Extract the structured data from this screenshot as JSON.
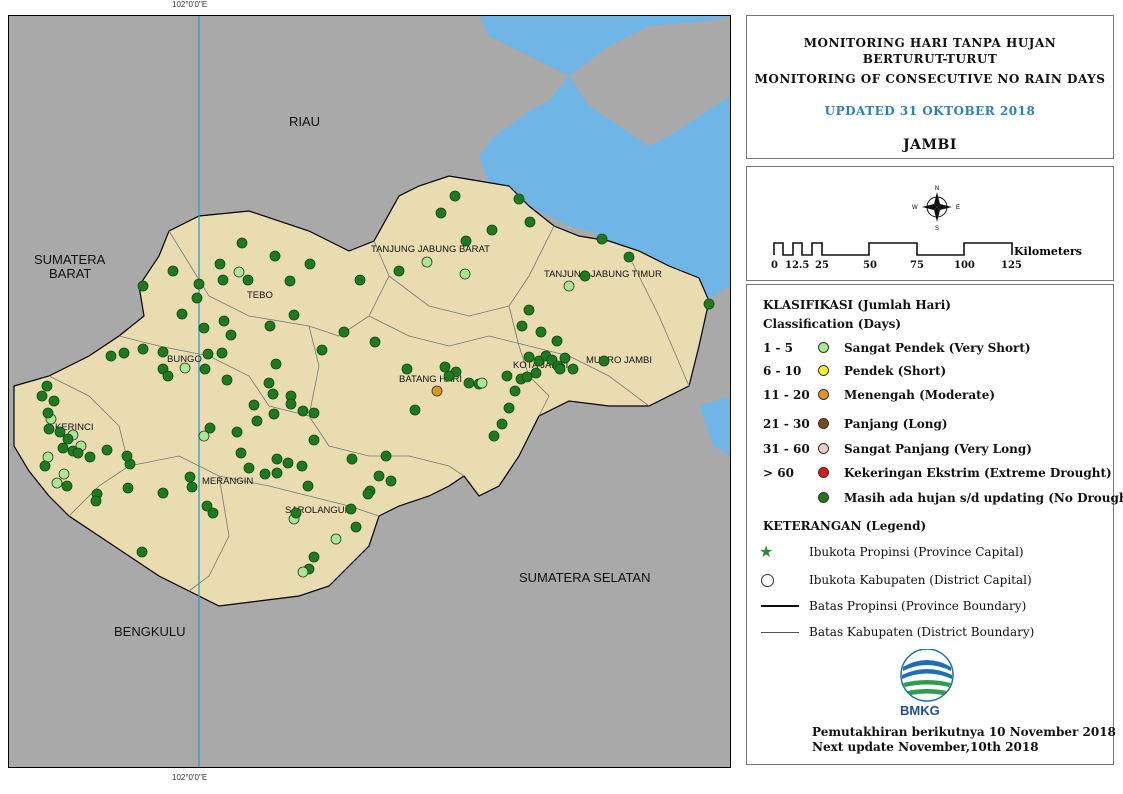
{
  "map": {
    "meridian_label": "102°0'0\"E",
    "regions": {
      "riau": "RIAU",
      "sumbar_1": "SUMATERA",
      "sumbar_2": "BARAT",
      "sumsel": "SUMATERA SELATAN",
      "bengkulu": "BENGKULU"
    },
    "districts": {
      "tebo": "TEBO",
      "tjb": "TANJUNG JABUNG BARAT",
      "tjt": "TANJUNG JABUNG TIMUR",
      "bungo": "BUNGO",
      "kota_jambi": "KOTA JAMBI",
      "muaro_jambi": "MUARO JAMBI",
      "batang_hari": "BATANG HARI",
      "kerinci": "KERINCI",
      "merangin": "MERANGIN",
      "sarolangun": "SAROLANGUN"
    },
    "colors": {
      "sea": "#6fb6e6",
      "land": "#a8a8a8",
      "province": "#e8dcb0",
      "no_drought": "#1f7a1f",
      "very_short": "#a8e890",
      "moderate": "#e0961f"
    }
  },
  "title": {
    "line1": "MONITORING HARI TANPA HUJAN",
    "line2": "BERTURUT-TURUT",
    "line3": "MONITORING OF CONSECUTIVE NO RAIN DAYS",
    "updated": "UPDATED 31 OKTOBER 2018",
    "province": "JAMBI"
  },
  "compass": {
    "n": "N",
    "s": "S",
    "e": "E",
    "w": "W"
  },
  "scale": {
    "unit": "Kilometers",
    "ticks": [
      "0",
      "12.5",
      "25",
      "50",
      "75",
      "100",
      "125"
    ]
  },
  "legend": {
    "klasifikasi": "KLASIFIKASI (Jumlah Hari)",
    "classification": "Classification (Days)",
    "classes": [
      {
        "range": "1 - 5",
        "label": "Sangat Pendek (Very Short)",
        "color": "#a8e890"
      },
      {
        "range": "6 - 10",
        "label": "Pendek (Short)",
        "color": "#f5f51e"
      },
      {
        "range": "11 - 20",
        "label": "Menengah (Moderate)",
        "color": "#e0961f"
      },
      {
        "range": "21 - 30",
        "label": "Panjang (Long)",
        "color": "#7a4a1a"
      },
      {
        "range": "31 - 60",
        "label": "Sangat Panjang (Very Long)",
        "color": "#f5c8c8"
      },
      {
        "range": "> 60",
        "label": "Kekeringan Ekstrim (Extreme Drought)",
        "color": "#e01818"
      },
      {
        "range": "",
        "label": "Masih ada hujan s/d updating (No Drought)",
        "color": "#1f7a1f"
      }
    ],
    "keterangan": "KETERANGAN (Legend)",
    "capital": "Ibukota Propinsi (Province Capital)",
    "district_capital": "Ibukota Kabupaten (District Capital)",
    "prov_boundary": "Batas Propinsi (Province Boundary)",
    "dist_boundary": "Batas Kabupaten (District Boundary)"
  },
  "footer": {
    "logo_text": "BMKG",
    "next_id": "Pemutakhiran berikutnya 10 November 2018",
    "next_en": "Next update November,10th 2018"
  }
}
